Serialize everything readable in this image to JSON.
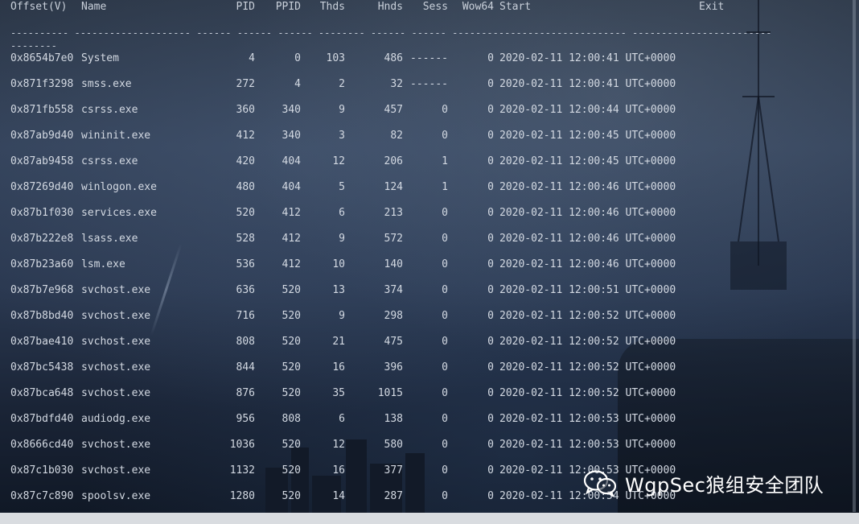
{
  "header": {
    "offset": "Offset(V)",
    "name": "Name",
    "pid": "PID",
    "ppid": "PPID",
    "thds": "Thds",
    "hnds": "Hnds",
    "sess": "Sess",
    "wow64": "Wow64",
    "start": "Start",
    "exit": "Exit"
  },
  "separator": {
    "line1": "---------- -------------------- ------ ------ ------ -------- ------ ------ ------------------------------ ------------------------",
    "line2": "--------"
  },
  "rows": [
    {
      "offset": "0x8654b7e0",
      "name": "System",
      "pid": "4",
      "ppid": "0",
      "thds": "103",
      "hnds": "486",
      "sess": "------",
      "wow64": "0",
      "start": "2020-02-11 12:00:41 UTC+0000"
    },
    {
      "offset": "0x871f3298",
      "name": "smss.exe",
      "pid": "272",
      "ppid": "4",
      "thds": "2",
      "hnds": "32",
      "sess": "------",
      "wow64": "0",
      "start": "2020-02-11 12:00:41 UTC+0000"
    },
    {
      "offset": "0x871fb558",
      "name": "csrss.exe",
      "pid": "360",
      "ppid": "340",
      "thds": "9",
      "hnds": "457",
      "sess": "0",
      "wow64": "0",
      "start": "2020-02-11 12:00:44 UTC+0000"
    },
    {
      "offset": "0x87ab9d40",
      "name": "wininit.exe",
      "pid": "412",
      "ppid": "340",
      "thds": "3",
      "hnds": "82",
      "sess": "0",
      "wow64": "0",
      "start": "2020-02-11 12:00:45 UTC+0000"
    },
    {
      "offset": "0x87ab9458",
      "name": "csrss.exe",
      "pid": "420",
      "ppid": "404",
      "thds": "12",
      "hnds": "206",
      "sess": "1",
      "wow64": "0",
      "start": "2020-02-11 12:00:45 UTC+0000"
    },
    {
      "offset": "0x87269d40",
      "name": "winlogon.exe",
      "pid": "480",
      "ppid": "404",
      "thds": "5",
      "hnds": "124",
      "sess": "1",
      "wow64": "0",
      "start": "2020-02-11 12:00:46 UTC+0000"
    },
    {
      "offset": "0x87b1f030",
      "name": "services.exe",
      "pid": "520",
      "ppid": "412",
      "thds": "6",
      "hnds": "213",
      "sess": "0",
      "wow64": "0",
      "start": "2020-02-11 12:00:46 UTC+0000"
    },
    {
      "offset": "0x87b222e8",
      "name": "lsass.exe",
      "pid": "528",
      "ppid": "412",
      "thds": "9",
      "hnds": "572",
      "sess": "0",
      "wow64": "0",
      "start": "2020-02-11 12:00:46 UTC+0000"
    },
    {
      "offset": "0x87b23a60",
      "name": "lsm.exe",
      "pid": "536",
      "ppid": "412",
      "thds": "10",
      "hnds": "140",
      "sess": "0",
      "wow64": "0",
      "start": "2020-02-11 12:00:46 UTC+0000"
    },
    {
      "offset": "0x87b7e968",
      "name": "svchost.exe",
      "pid": "636",
      "ppid": "520",
      "thds": "13",
      "hnds": "374",
      "sess": "0",
      "wow64": "0",
      "start": "2020-02-11 12:00:51 UTC+0000"
    },
    {
      "offset": "0x87b8bd40",
      "name": "svchost.exe",
      "pid": "716",
      "ppid": "520",
      "thds": "9",
      "hnds": "298",
      "sess": "0",
      "wow64": "0",
      "start": "2020-02-11 12:00:52 UTC+0000"
    },
    {
      "offset": "0x87bae410",
      "name": "svchost.exe",
      "pid": "808",
      "ppid": "520",
      "thds": "21",
      "hnds": "475",
      "sess": "0",
      "wow64": "0",
      "start": "2020-02-11 12:00:52 UTC+0000"
    },
    {
      "offset": "0x87bc5438",
      "name": "svchost.exe",
      "pid": "844",
      "ppid": "520",
      "thds": "16",
      "hnds": "396",
      "sess": "0",
      "wow64": "0",
      "start": "2020-02-11 12:00:52 UTC+0000"
    },
    {
      "offset": "0x87bca648",
      "name": "svchost.exe",
      "pid": "876",
      "ppid": "520",
      "thds": "35",
      "hnds": "1015",
      "sess": "0",
      "wow64": "0",
      "start": "2020-02-11 12:00:52 UTC+0000"
    },
    {
      "offset": "0x87bdfd40",
      "name": "audiodg.exe",
      "pid": "956",
      "ppid": "808",
      "thds": "6",
      "hnds": "138",
      "sess": "0",
      "wow64": "0",
      "start": "2020-02-11 12:00:53 UTC+0000"
    },
    {
      "offset": "0x8666cd40",
      "name": "svchost.exe",
      "pid": "1036",
      "ppid": "520",
      "thds": "12",
      "hnds": "580",
      "sess": "0",
      "wow64": "0",
      "start": "2020-02-11 12:00:53 UTC+0000"
    },
    {
      "offset": "0x87c1b030",
      "name": "svchost.exe",
      "pid": "1132",
      "ppid": "520",
      "thds": "16",
      "hnds": "377",
      "sess": "0",
      "wow64": "0",
      "start": "2020-02-11 12:00:53 UTC+0000"
    },
    {
      "offset": "0x87c7c890",
      "name": "spoolsv.exe",
      "pid": "1280",
      "ppid": "520",
      "thds": "14",
      "hnds": "287",
      "sess": "0",
      "wow64": "0",
      "start": "2020-02-11 12:00:54 UTC+0000"
    }
  ],
  "watermark": {
    "text": "WgpSec狼组安全团队",
    "icon": "wechat-icon"
  }
}
